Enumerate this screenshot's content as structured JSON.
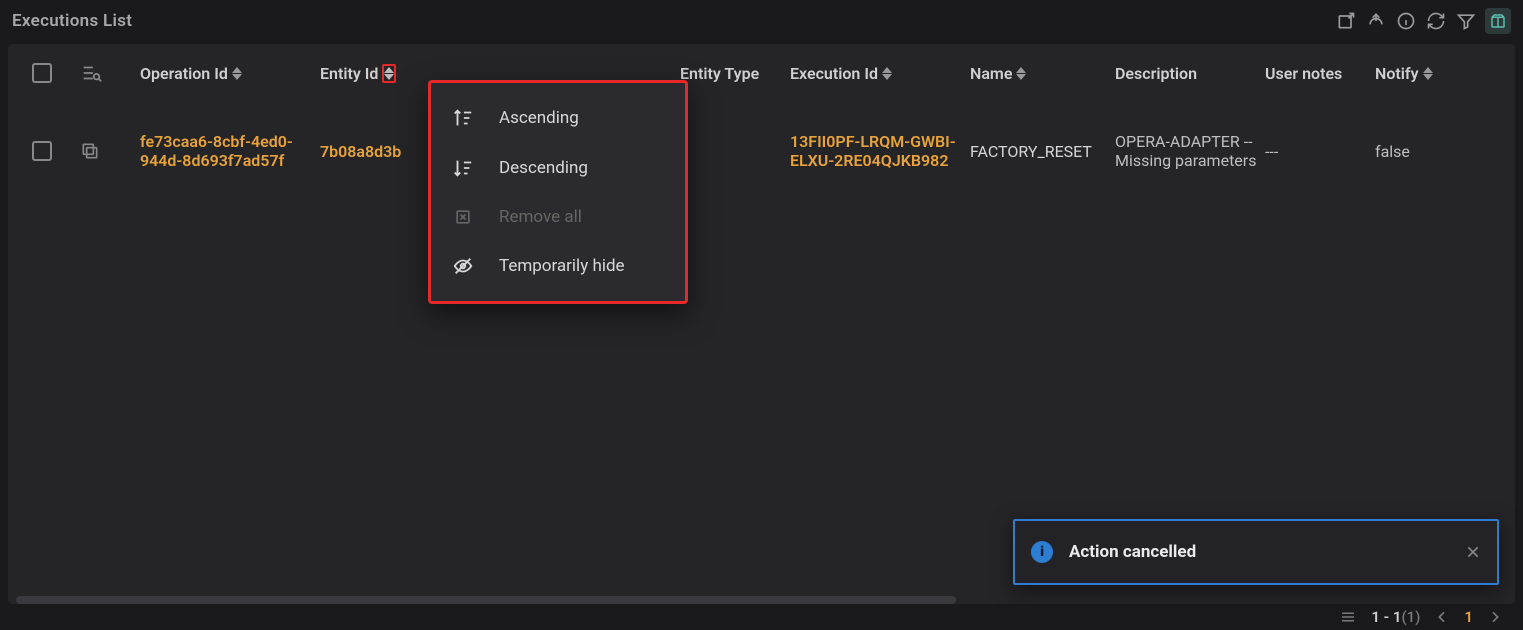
{
  "title": "Executions List",
  "columns": {
    "operation_id": "Operation Id",
    "entity_id": "Entity Id",
    "entity_type": "Entity Type",
    "execution_id": "Execution Id",
    "name": "Name",
    "description": "Description",
    "user_notes": "User notes",
    "notify": "Notify"
  },
  "row": {
    "operation_id": "fe73caa6-8cbf-4ed0-944d-8d693f7ad57f",
    "entity_id": "7b08a8d3b",
    "execution_id": "13FII0PF-LRQM-GWBI-ELXU-2RE04QJKB982",
    "name": "FACTORY_RESET",
    "description": "OPERA-ADAPTER -- Missing parameters",
    "user_notes": "---",
    "notify": "false"
  },
  "dropdown": {
    "ascending": "Ascending",
    "descending": "Descending",
    "remove_all": "Remove all",
    "temporarily_hide": "Temporarily hide"
  },
  "toast": {
    "text": "Action cancelled"
  },
  "pager": {
    "range": "1 - 1",
    "total": "(1)",
    "page": "1"
  }
}
